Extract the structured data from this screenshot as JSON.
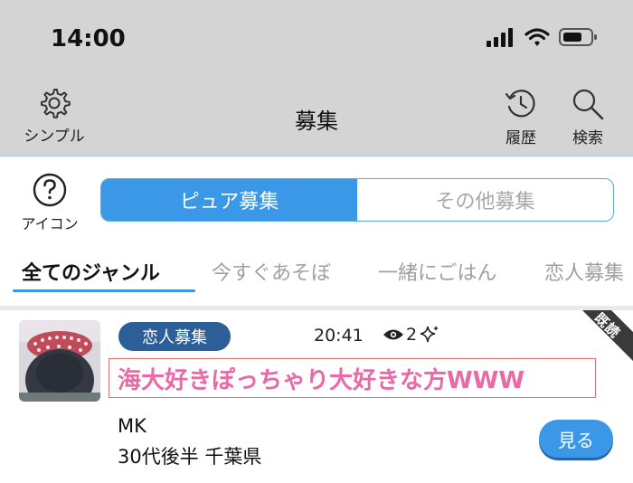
{
  "status_bar": {
    "time": "14:00"
  },
  "nav": {
    "title": "募集",
    "left_button": {
      "label": "シンプル",
      "icon": "gear-icon"
    },
    "history_button": {
      "label": "履歴",
      "icon": "history-icon"
    },
    "search_button": {
      "label": "検索",
      "icon": "search-icon"
    }
  },
  "help": {
    "label": "アイコン",
    "icon": "question-icon"
  },
  "segments": [
    {
      "label": "ピュア募集",
      "active": true
    },
    {
      "label": "その他募集",
      "active": false
    }
  ],
  "genres": [
    {
      "label": "全てのジャンル",
      "active": true
    },
    {
      "label": "今すぐあそぼ",
      "active": false
    },
    {
      "label": "一緒にごはん",
      "active": false
    },
    {
      "label": "恋人募集",
      "active": false
    }
  ],
  "post": {
    "category": "恋人募集",
    "time": "20:41",
    "views": "2",
    "title": "海大好きぽっちゃり大好きな方WWW",
    "name": "MK",
    "meta": "30代後半 千葉県",
    "view_button": "見る",
    "read_badge": "既読"
  },
  "colors": {
    "accent": "#3a98e6",
    "badge": "#2c5f98",
    "title": "#e86aa6",
    "header": "#d4d4d4"
  }
}
